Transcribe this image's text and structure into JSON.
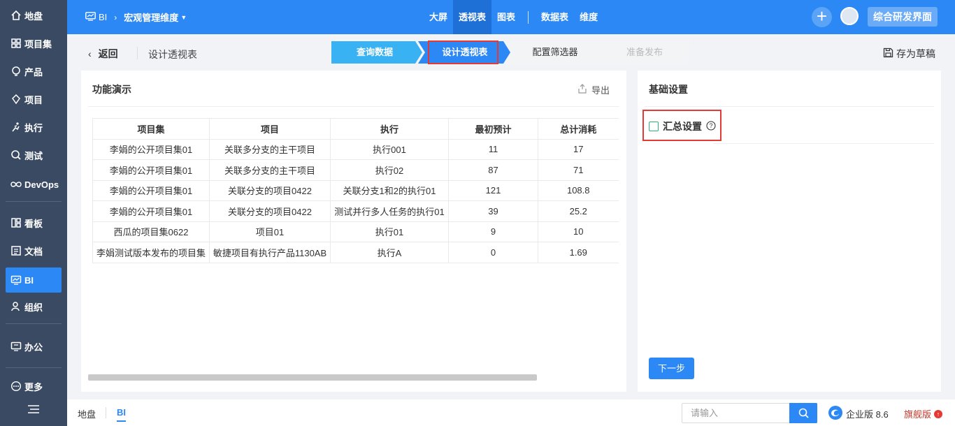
{
  "sidebar": {
    "items": [
      {
        "label": "地盘",
        "icon": "home-icon"
      },
      {
        "label": "项目集",
        "icon": "grid-icon"
      },
      {
        "label": "产品",
        "icon": "product-icon"
      },
      {
        "label": "项目",
        "icon": "project-icon"
      },
      {
        "label": "执行",
        "icon": "run-icon"
      },
      {
        "label": "测试",
        "icon": "test-icon"
      },
      {
        "label": "DevOps",
        "icon": "infinity-icon"
      },
      {
        "label": "看板",
        "icon": "board-icon"
      },
      {
        "label": "文档",
        "icon": "doc-icon"
      },
      {
        "label": "BI",
        "icon": "monitor-icon"
      },
      {
        "label": "组织",
        "icon": "user-icon"
      },
      {
        "label": "办公",
        "icon": "office-icon"
      },
      {
        "label": "更多",
        "icon": "more-icon"
      }
    ],
    "active": "BI"
  },
  "topbar": {
    "module": "BI",
    "breadcrumb": "宏观管理维度",
    "nav": [
      "大屏",
      "透视表",
      "图表",
      "数据表",
      "维度"
    ],
    "nav_active": "透视表",
    "workspace_button": "综合研发界面"
  },
  "subbar": {
    "back": "返回",
    "page_title": "设计透视表",
    "steps": [
      "查询数据",
      "设计透视表",
      "配置筛选器",
      "准备发布"
    ],
    "current_step": "设计透视表",
    "save_draft": "存为草稿"
  },
  "left_panel": {
    "title": "功能演示",
    "export": "导出",
    "table": {
      "columns": [
        "项目集",
        "项目",
        "执行",
        "最初预计",
        "总计消耗"
      ],
      "rows": [
        [
          "李娟的公开项目集01",
          "关联多分支的主干项目",
          "执行001",
          "11",
          "17"
        ],
        [
          "李娟的公开项目集01",
          "关联多分支的主干项目",
          "执行02",
          "87",
          "71"
        ],
        [
          "李娟的公开项目集01",
          "关联分支的项目0422",
          "关联分支1和2的执行01",
          "121",
          "108.8"
        ],
        [
          "李娟的公开项目集01",
          "关联分支的项目0422",
          "测试并行多人任务的执行01",
          "39",
          "25.2"
        ],
        [
          "西瓜的项目集0622",
          "项目01",
          "执行01",
          "9",
          "10"
        ],
        [
          "李娟测试版本发布的项目集",
          "敏捷项目有执行产品1130AB",
          "执行A",
          "0",
          "1.69"
        ]
      ]
    }
  },
  "right_panel": {
    "title": "基础设置",
    "summary_label": "汇总设置",
    "summary_checked": false,
    "next_button": "下一步"
  },
  "footer": {
    "tabs": [
      "地盘",
      "BI"
    ],
    "active_tab": "BI",
    "search_placeholder": "请输入",
    "edition": "企业版 8.6",
    "flagship": "旗舰版"
  },
  "colors": {
    "primary": "#2b88f5",
    "sidebar": "#3a4a62",
    "highlight": "#e53935"
  }
}
